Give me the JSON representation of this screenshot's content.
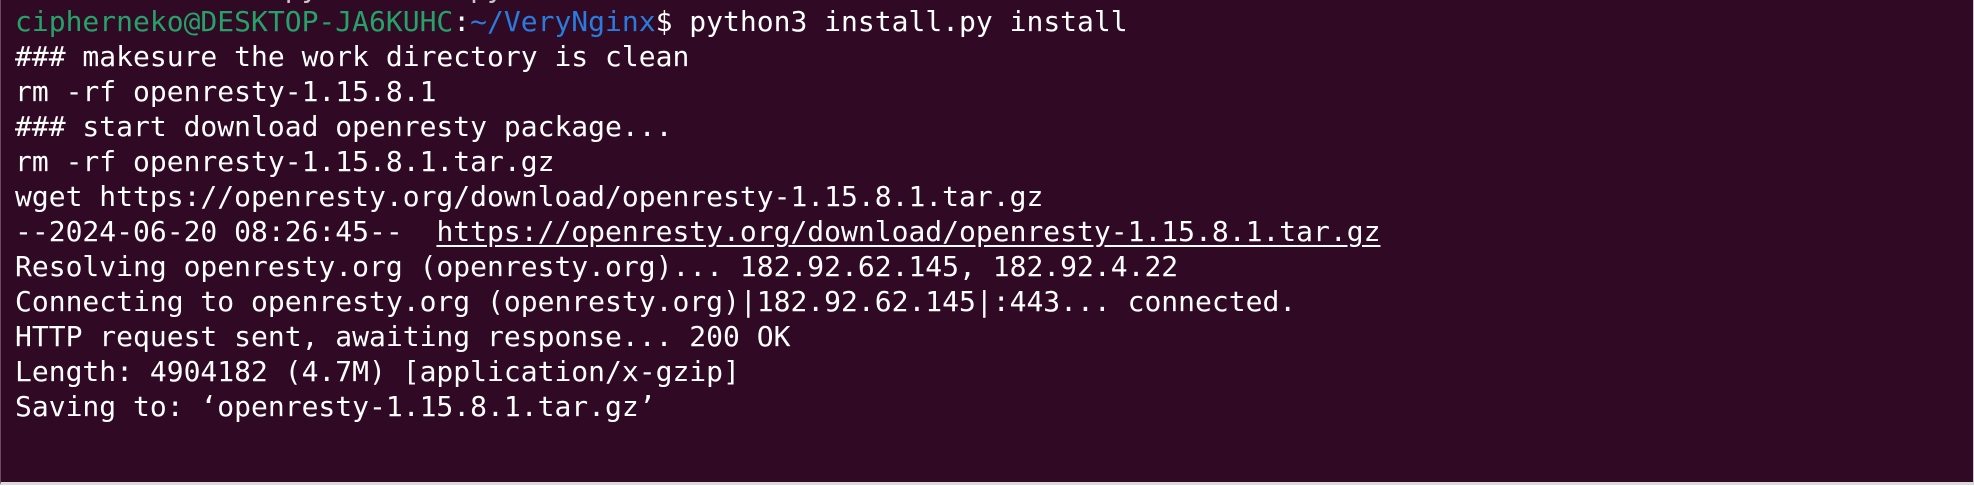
{
  "prompt": {
    "user_host": "cipherneko@DESKTOP-JA6KUHC",
    "separator": ":",
    "path": "~/VeryNginx",
    "symbol": "$",
    "command": " python3 install.py install"
  },
  "output": {
    "line1": "### makesure the work directory is clean",
    "line2": "rm -rf openresty-1.15.8.1",
    "line3": "### start download openresty package...",
    "line4": "rm -rf openresty-1.15.8.1.tar.gz",
    "line5": "wget https://openresty.org/download/openresty-1.15.8.1.tar.gz",
    "line6_prefix": "--2024-06-20 08:26:45--  ",
    "line6_url": "https://openresty.org/download/openresty-1.15.8.1.tar.gz",
    "line7": "Resolving openresty.org (openresty.org)... 182.92.62.145, 182.92.4.22",
    "line8": "Connecting to openresty.org (openresty.org)|182.92.62.145|:443... connected.",
    "line9": "HTTP request sent, awaiting response... 200 OK",
    "line10": "Length: 4904182 (4.7M) [application/x-gzip]",
    "line11": "Saving to: ‘openresty-1.15.8.1.tar.gz’"
  },
  "colors": {
    "background": "#300a24",
    "text": "#ffffff",
    "user_host": "#26a269",
    "path": "#2a7bde"
  }
}
